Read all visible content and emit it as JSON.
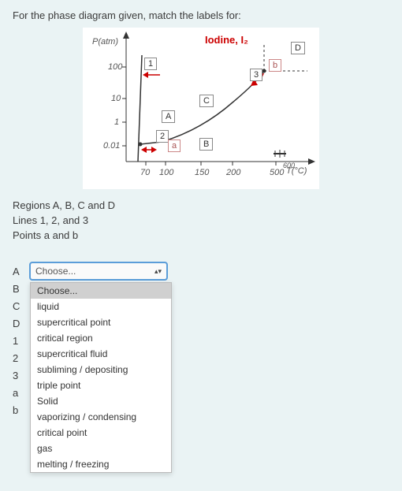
{
  "prompt": "For the phase diagram given, match the labels for:",
  "diagram": {
    "title": "Iodine, I₂",
    "y_axis_label": "P(atm)",
    "x_axis_label": "T(°C)",
    "y_ticks": [
      "0.01",
      "1",
      "10",
      "100"
    ],
    "x_ticks": [
      "70",
      "100",
      "150",
      "200",
      "500"
    ],
    "x_extra_tick": "600",
    "region_labels": {
      "A": "A",
      "B": "B",
      "C": "C",
      "D": "D"
    },
    "line_labels": {
      "1": "1",
      "2": "2",
      "3": "3"
    },
    "point_labels": {
      "a": "a",
      "b": "b"
    }
  },
  "subprompts": [
    "Regions A, B, C and D",
    "Lines 1, 2, and 3",
    "Points a and b"
  ],
  "rows": [
    "A",
    "B",
    "C",
    "D",
    "1",
    "2",
    "3",
    "a",
    "b"
  ],
  "select_placeholder": "Choose...",
  "dropdown_options": [
    "Choose...",
    "liquid",
    "supercritical point",
    "critical region",
    "supercritical fluid",
    "subliming / depositing",
    "triple point",
    "Solid",
    "vaporizing / condensing",
    "critical point",
    "gas",
    "melting / freezing"
  ]
}
